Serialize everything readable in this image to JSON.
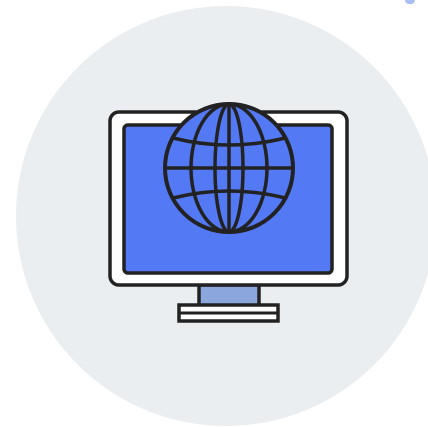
{
  "illustration": {
    "subject": "monitor-globe",
    "icon": "globe-icon",
    "colors": {
      "background": "#ffffff",
      "circle": "#ebeef1",
      "outline": "#222222",
      "bezel": "#ffffff",
      "screen": "#5479f5",
      "globe_fill": "#5479f5",
      "neck": "#8aa6dc",
      "base": "#ffffff",
      "corner_mark": "#a9bff2"
    }
  }
}
